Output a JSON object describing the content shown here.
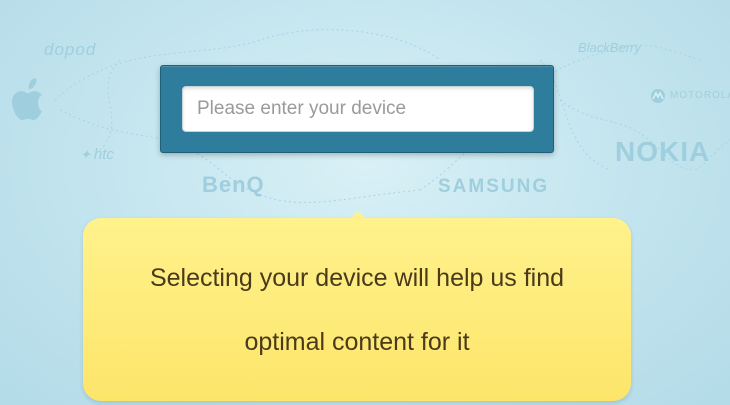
{
  "background": {
    "brands": {
      "dopod": "dopod",
      "htc": "htc",
      "benq": "BenQ",
      "samsung": "SAMSUNG",
      "blackberry": "BlackBerry",
      "motorola": "MOTOROLA",
      "nokia": "NOKIA"
    },
    "colors": {
      "background": "#c2e4ee",
      "logo": "#9fcfde"
    }
  },
  "search": {
    "placeholder": "Please enter your device",
    "value": "",
    "panel_color": "#2f7d9c"
  },
  "tooltip": {
    "line1": "Selecting your device will help us find",
    "line2": "optimal content for it",
    "color": "#fde56a"
  }
}
